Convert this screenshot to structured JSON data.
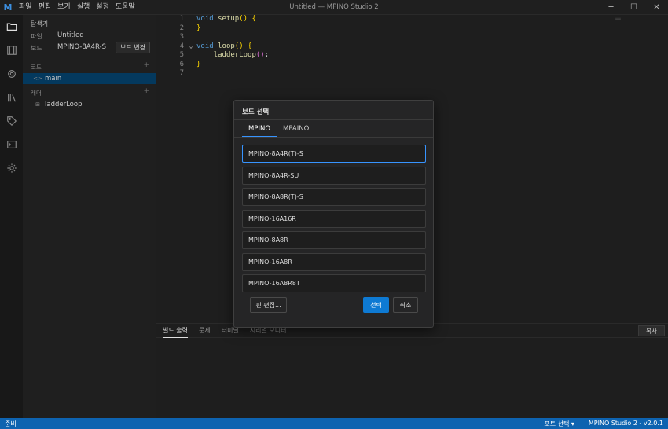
{
  "app": {
    "window_title": "Untitled — MPINO Studio 2",
    "logo": "M",
    "menu": [
      "파일",
      "편집",
      "보기",
      "실행",
      "설정",
      "도움말"
    ],
    "controls": {
      "minimize": "─",
      "maximize": "☐",
      "close": "✕"
    }
  },
  "activitybar": {
    "icons": [
      "folder-icon",
      "layout-icon",
      "chip-icon",
      "library-icon",
      "tag-icon",
      "terminal-icon",
      "gear-icon"
    ]
  },
  "sidebar": {
    "title": "탐색기",
    "file_label": "파일",
    "file_value": "Untitled",
    "board_label": "보드",
    "board_value": "MPINO-8A4R-S",
    "board_change_button": "보드 변경",
    "code_section": "코드",
    "code_items": [
      {
        "icon": "<>",
        "label": "main"
      }
    ],
    "ladder_section": "래더",
    "ladder_items": [
      {
        "icon": "⊞",
        "label": "ladderLoop"
      }
    ],
    "add": "+"
  },
  "editor": {
    "line_numbers": [
      "1",
      "2",
      "3",
      "4",
      "5",
      "6",
      "7"
    ]
  },
  "panel": {
    "tabs": [
      "빌드 출력",
      "문제",
      "터미널",
      "시리얼 모니터"
    ],
    "copy_button": "복사"
  },
  "statusbar": {
    "left": "준비",
    "port": "포트 선택 ▾",
    "version": "MPINO Studio 2 - v2.0.1"
  },
  "dialog": {
    "title": "보드 선택",
    "tabs": [
      "MPINO",
      "MPAINO"
    ],
    "active_tab": "MPINO",
    "boards": [
      "MPINO-8A4R(T)-S",
      "MPINO-8A4R-SU",
      "MPINO-8A8R(T)-S",
      "MPINO-16A16R",
      "MPINO-8A8R",
      "MPINO-16A8R",
      "MPINO-16A8R8T"
    ],
    "selected_board": "MPINO-8A4R(T)-S",
    "pin_edit_button": "핀 편집...",
    "select_button": "선택",
    "cancel_button": "취소"
  },
  "colors": {
    "accent": "#0e7ad3",
    "statusbar": "#0e63b0",
    "keyword": "#569cd6",
    "function": "#dcdcaa",
    "selection": "#04395e"
  }
}
